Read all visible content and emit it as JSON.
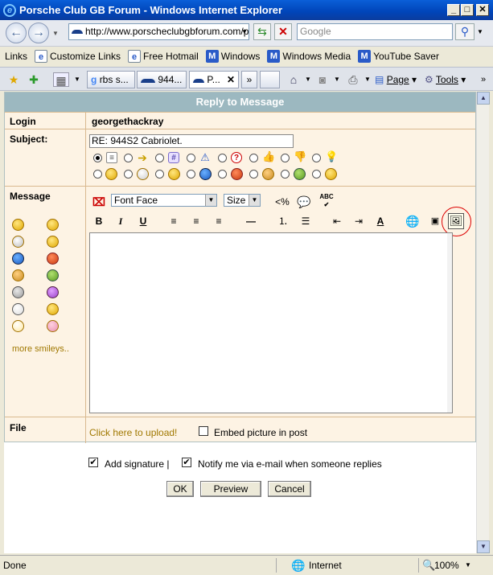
{
  "window": {
    "title": "Porsche Club GB Forum - Windows Internet Explorer"
  },
  "address": {
    "url": "http://www.porscheclubgbforum.com/p",
    "search_placeholder": "Google"
  },
  "links": {
    "label": "Links",
    "items": [
      "Customize Links",
      "Free Hotmail",
      "Windows",
      "Windows Media",
      "YouTube Saver"
    ]
  },
  "tabs": {
    "items": [
      "rbs s...",
      "944...",
      "P..."
    ],
    "page_menu": "Page",
    "tools_menu": "Tools"
  },
  "form": {
    "header": "Reply to Message",
    "login_label": "Login",
    "login_value": "georgethackray",
    "subject_label": "Subject:",
    "subject_value": "RE: 944S2 Cabriolet.",
    "message_label": "Message",
    "more_smileys": "more smileys..",
    "font_face": "Font Face",
    "font_size": "Size",
    "file_label": "File",
    "upload_link": "Click here to upload!",
    "embed_label": "Embed picture in post",
    "add_signature": "Add signature |",
    "notify": "Notify me via e-mail when someone replies",
    "ok": "OK",
    "preview": "Preview",
    "cancel": "Cancel"
  },
  "status": {
    "left": "Done",
    "zone": "Internet",
    "zoom": "100%"
  },
  "colors": {
    "header_bg": "#9cb8c0",
    "form_bg": "#fdf3e4",
    "title_bar": "#0a5fd8",
    "link_color": "#a07800"
  }
}
